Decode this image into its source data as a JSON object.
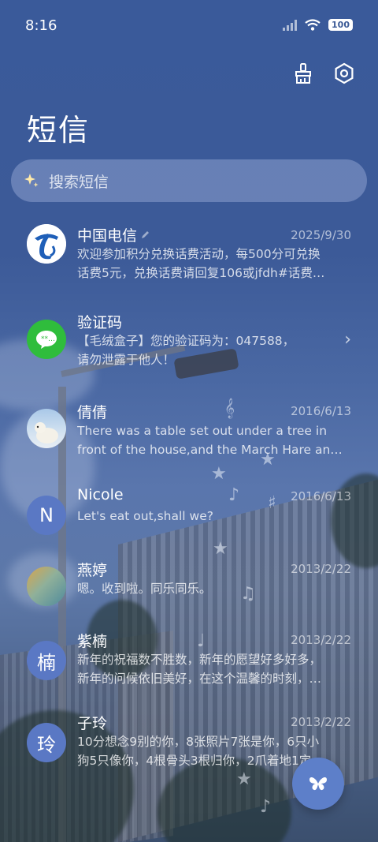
{
  "status_bar": {
    "time": "8:16",
    "battery": "100"
  },
  "header": {
    "title": "短信",
    "icons": [
      "broom-icon",
      "settings-hex-icon"
    ]
  },
  "search": {
    "placeholder": "搜索短信",
    "icon": "sparkle-icon"
  },
  "conversations": [
    {
      "name": "中国电信",
      "date": "2025/9/30",
      "line1": "欢迎参加积分兑换话费活动，每500分可兑换",
      "line2": "话费5元，兑换话费请回复106或jfdh#话费…",
      "avatar_text": "",
      "avatar_color": "#1f5fb8",
      "avatar_icon": "china-telecom-logo-icon"
    },
    {
      "name": "验证码",
      "date": "",
      "line1": "【毛绒盒子】您的验证码为：047588，",
      "line2": "请勿泄露于他人！",
      "avatar_text": "",
      "avatar_color": "#2fbd3c",
      "avatar_icon": "message-bubble-icon"
    },
    {
      "name": "倩倩",
      "date": "2016/6/13",
      "line1": "There was a table set out under a tree in",
      "line2": "front of the house,and the March Hare an…",
      "avatar_text": "",
      "avatar_color": "#8fb6dc",
      "avatar_icon": "polar-bear-photo"
    },
    {
      "name": "Nicole",
      "date": "2016/6/13",
      "line1": "Let's eat out,shall we?",
      "line2": "",
      "avatar_text": "N",
      "avatar_color": "#5a78c4",
      "avatar_icon": ""
    },
    {
      "name": "燕婷",
      "date": "2013/2/22",
      "line1": "嗯。收到啦。同乐同乐。",
      "line2": "",
      "avatar_text": "",
      "avatar_color": "#7fa4a0",
      "avatar_icon": "landscape-photo"
    },
    {
      "name": "紫楠",
      "date": "2013/2/22",
      "line1": "新年的祝福数不胜数，新年的愿望好多好多，",
      "line2": "新年的问候依旧美好，在这个温馨的时刻，…",
      "avatar_text": "楠",
      "avatar_color": "#5a78c4",
      "avatar_icon": ""
    },
    {
      "name": "子玲",
      "date": "2013/2/22",
      "line1": "10分想念9别的你，8张照片7张是你，6只小",
      "line2": "狗5只像你，4根骨头3根归你，2爪着地1定…",
      "avatar_text": "玲",
      "avatar_color": "#5a78c4",
      "avatar_icon": ""
    }
  ],
  "fab": {
    "icon": "butterfly-icon"
  }
}
